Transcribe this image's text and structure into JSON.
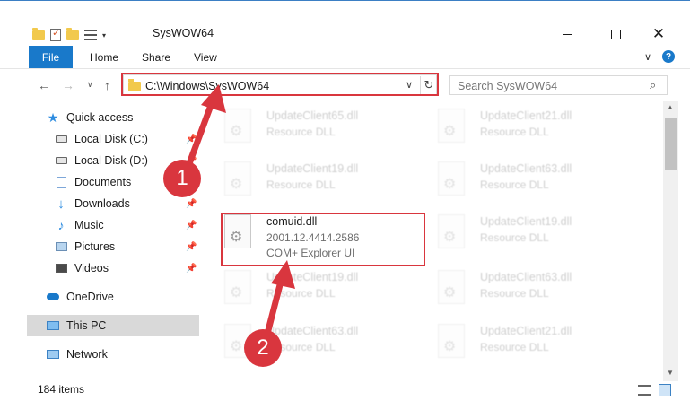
{
  "window": {
    "title": "SysWOW64",
    "close_glyph": "✕"
  },
  "ribbon": {
    "tabs": [
      "File",
      "Home",
      "Share",
      "View"
    ],
    "chevron": "∨",
    "help": "?"
  },
  "nav": {
    "back": "←",
    "forward": "→",
    "recent": "∨",
    "up": "↑"
  },
  "address": {
    "path": "C:\\Windows\\SysWOW64",
    "dropdown": "∨",
    "refresh": "↻"
  },
  "search": {
    "placeholder": "Search SysWOW64",
    "icon": "⌕"
  },
  "navpane": {
    "items": [
      {
        "label": "Quick access",
        "icon": "star-icon",
        "pinned": false
      },
      {
        "label": "Local Disk (C:)",
        "icon": "drive-icon",
        "pinned": true
      },
      {
        "label": "Local Disk (D:)",
        "icon": "drive-icon",
        "pinned": true
      },
      {
        "label": "Documents",
        "icon": "documents-icon",
        "pinned": true
      },
      {
        "label": "Downloads",
        "icon": "download-icon",
        "pinned": true
      },
      {
        "label": "Music",
        "icon": "music-icon",
        "pinned": true
      },
      {
        "label": "Pictures",
        "icon": "pictures-icon",
        "pinned": true
      },
      {
        "label": "Videos",
        "icon": "videos-icon",
        "pinned": true
      },
      {
        "label": "OneDrive",
        "icon": "cloud-icon",
        "pinned": false
      },
      {
        "label": "This PC",
        "icon": "computer-icon",
        "pinned": false,
        "selected": true
      },
      {
        "label": "Network",
        "icon": "network-icon",
        "pinned": false
      }
    ],
    "pin_glyph": "📌"
  },
  "files": {
    "left": [
      {
        "name": "UpdateClient65.dll",
        "sub": "Resource DLL"
      },
      {
        "name": "UpdateClient19.dll",
        "sub": "Resource DLL"
      },
      {
        "name": "comuid.dll",
        "sub": "2001.12.4414.2586",
        "sub2": "COM+ Explorer UI"
      },
      {
        "name": "UpdateClient19.dll",
        "sub": "Resource DLL"
      },
      {
        "name": "UpdateClient63.dll",
        "sub": "Resource DLL"
      }
    ],
    "right": [
      {
        "name": "UpdateClient21.dll",
        "sub": "Resource DLL"
      },
      {
        "name": "UpdateClient63.dll",
        "sub": "Resource DLL"
      },
      {
        "name": "UpdateClient19.dll",
        "sub": "Resource DLL"
      },
      {
        "name": "UpdateClient63.dll",
        "sub": "Resource DLL"
      },
      {
        "name": "UpdateClient21.dll",
        "sub": "Resource DLL"
      }
    ]
  },
  "status": {
    "count": "184 items"
  },
  "callouts": {
    "step1": "1",
    "step2": "2"
  },
  "colors": {
    "accent": "#1979ca",
    "callout": "#d9363e"
  }
}
